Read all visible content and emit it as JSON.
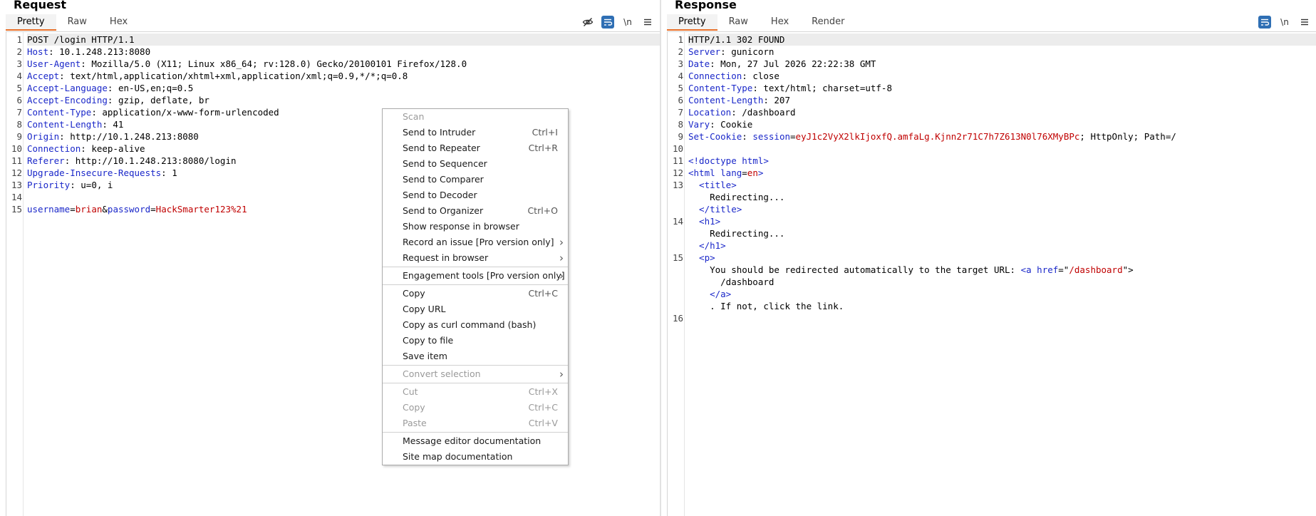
{
  "request": {
    "title": "Request",
    "tabs": [
      "Pretty",
      "Raw",
      "Hex"
    ],
    "active_tab": "Pretty",
    "toolbar_icons": [
      "eye-slash-icon",
      "wrap-lines-icon",
      "newline-icon",
      "menu-icon"
    ],
    "newline_label": "\\n",
    "lines": [
      {
        "n": "1",
        "parts": [
          {
            "t": "POST /login HTTP/1.1",
            "c": "v"
          }
        ]
      },
      {
        "n": "2",
        "parts": [
          {
            "t": "Host",
            "c": "k"
          },
          {
            "t": ": 10.1.248.213:8080",
            "c": "v"
          }
        ]
      },
      {
        "n": "3",
        "parts": [
          {
            "t": "User-Agent",
            "c": "k"
          },
          {
            "t": ": Mozilla/5.0 (X11; Linux x86_64; rv:128.0) Gecko/20100101 Firefox/128.0",
            "c": "v"
          }
        ]
      },
      {
        "n": "4",
        "parts": [
          {
            "t": "Accept",
            "c": "k"
          },
          {
            "t": ": text/html,application/xhtml+xml,application/xml;q=0.9,*/*;q=0.8",
            "c": "v"
          }
        ]
      },
      {
        "n": "5",
        "parts": [
          {
            "t": "Accept-Language",
            "c": "k"
          },
          {
            "t": ": en-US,en;q=0.5",
            "c": "v"
          }
        ]
      },
      {
        "n": "6",
        "parts": [
          {
            "t": "Accept-Encoding",
            "c": "k"
          },
          {
            "t": ": gzip, deflate, br",
            "c": "v"
          }
        ]
      },
      {
        "n": "7",
        "parts": [
          {
            "t": "Content-Type",
            "c": "k"
          },
          {
            "t": ": application/x-www-form-urlencoded",
            "c": "v"
          }
        ]
      },
      {
        "n": "8",
        "parts": [
          {
            "t": "Content-Length",
            "c": "k"
          },
          {
            "t": ": 41",
            "c": "v"
          }
        ]
      },
      {
        "n": "9",
        "parts": [
          {
            "t": "Origin",
            "c": "k"
          },
          {
            "t": ": http://10.1.248.213:8080",
            "c": "v"
          }
        ]
      },
      {
        "n": "10",
        "parts": [
          {
            "t": "Connection",
            "c": "k"
          },
          {
            "t": ": keep-alive",
            "c": "v"
          }
        ]
      },
      {
        "n": "11",
        "parts": [
          {
            "t": "Referer",
            "c": "k"
          },
          {
            "t": ": http://10.1.248.213:8080/login",
            "c": "v"
          }
        ]
      },
      {
        "n": "12",
        "parts": [
          {
            "t": "Upgrade-Insecure-Requests",
            "c": "k"
          },
          {
            "t": ": 1",
            "c": "v"
          }
        ]
      },
      {
        "n": "13",
        "parts": [
          {
            "t": "Priority",
            "c": "k"
          },
          {
            "t": ": u=0, i",
            "c": "v"
          }
        ]
      },
      {
        "n": "14",
        "parts": []
      },
      {
        "n": "15",
        "parts": [
          {
            "t": "username",
            "c": "k"
          },
          {
            "t": "=",
            "c": "v"
          },
          {
            "t": "brian",
            "c": "r"
          },
          {
            "t": "&",
            "c": "v"
          },
          {
            "t": "password",
            "c": "k"
          },
          {
            "t": "=",
            "c": "v"
          },
          {
            "t": "HackSmarter123%21",
            "c": "r"
          }
        ]
      }
    ]
  },
  "response": {
    "title": "Response",
    "tabs": [
      "Pretty",
      "Raw",
      "Hex",
      "Render"
    ],
    "active_tab": "Pretty",
    "toolbar_icons": [
      "wrap-lines-icon",
      "newline-icon",
      "menu-icon"
    ],
    "newline_label": "\\n",
    "lines": [
      {
        "n": "1",
        "parts": [
          {
            "t": "HTTP/1.1 302 FOUND",
            "c": "v"
          }
        ]
      },
      {
        "n": "2",
        "parts": [
          {
            "t": "Server",
            "c": "k"
          },
          {
            "t": ": gunicorn",
            "c": "v"
          }
        ]
      },
      {
        "n": "3",
        "parts": [
          {
            "t": "Date",
            "c": "k"
          },
          {
            "t": ": Mon, 27 Jul 2026 22:22:38 GMT",
            "c": "v"
          }
        ]
      },
      {
        "n": "4",
        "parts": [
          {
            "t": "Connection",
            "c": "k"
          },
          {
            "t": ": close",
            "c": "v"
          }
        ]
      },
      {
        "n": "5",
        "parts": [
          {
            "t": "Content-Type",
            "c": "k"
          },
          {
            "t": ": text/html; charset=utf-8",
            "c": "v"
          }
        ]
      },
      {
        "n": "6",
        "parts": [
          {
            "t": "Content-Length",
            "c": "k"
          },
          {
            "t": ": 207",
            "c": "v"
          }
        ]
      },
      {
        "n": "7",
        "parts": [
          {
            "t": "Location",
            "c": "k"
          },
          {
            "t": ": /dashboard",
            "c": "v"
          }
        ]
      },
      {
        "n": "8",
        "parts": [
          {
            "t": "Vary",
            "c": "k"
          },
          {
            "t": ": Cookie",
            "c": "v"
          }
        ]
      },
      {
        "n": "9",
        "parts": [
          {
            "t": "Set-Cookie",
            "c": "k"
          },
          {
            "t": ": ",
            "c": "v"
          },
          {
            "t": "session",
            "c": "k"
          },
          {
            "t": "=",
            "c": "v"
          },
          {
            "t": "eyJ1c2VyX2lkIjoxfQ.amfaLg.Kjnn2r71C7h7Z613N0l76XMyBPc",
            "c": "r"
          },
          {
            "t": "; HttpOnly; Path=/",
            "c": "v"
          }
        ]
      },
      {
        "n": "10",
        "parts": []
      },
      {
        "n": "11",
        "parts": [
          {
            "t": "<!doctype html>",
            "c": "tg"
          }
        ]
      },
      {
        "n": "12",
        "parts": [
          {
            "t": "<html ",
            "c": "tg"
          },
          {
            "t": "lang",
            "c": "k"
          },
          {
            "t": "=",
            "c": "v"
          },
          {
            "t": "en",
            "c": "r"
          },
          {
            "t": ">",
            "c": "tg"
          }
        ]
      },
      {
        "n": "13",
        "parts": [
          {
            "t": "  <title>",
            "c": "tg"
          }
        ]
      },
      {
        "n": "",
        "parts": [
          {
            "t": "    Redirecting...",
            "c": "v"
          }
        ]
      },
      {
        "n": "",
        "parts": [
          {
            "t": "  </title>",
            "c": "tg"
          }
        ]
      },
      {
        "n": "14",
        "parts": [
          {
            "t": "  <h1>",
            "c": "tg"
          }
        ]
      },
      {
        "n": "",
        "parts": [
          {
            "t": "    Redirecting...",
            "c": "v"
          }
        ]
      },
      {
        "n": "",
        "parts": [
          {
            "t": "  </h1>",
            "c": "tg"
          }
        ]
      },
      {
        "n": "15",
        "parts": [
          {
            "t": "  <p>",
            "c": "tg"
          }
        ]
      },
      {
        "n": "",
        "parts": [
          {
            "t": "    You should be redirected automatically to the target URL: ",
            "c": "v"
          },
          {
            "t": "<a ",
            "c": "tg"
          },
          {
            "t": "href",
            "c": "k"
          },
          {
            "t": "=\"",
            "c": "v"
          },
          {
            "t": "/dashboard",
            "c": "r"
          },
          {
            "t": "\">",
            "c": "v"
          }
        ]
      },
      {
        "n": "",
        "parts": [
          {
            "t": "      /dashboard",
            "c": "v"
          }
        ]
      },
      {
        "n": "",
        "parts": [
          {
            "t": "    </a>",
            "c": "tg"
          }
        ]
      },
      {
        "n": "",
        "parts": [
          {
            "t": "    . If not, click the link.",
            "c": "v"
          }
        ]
      },
      {
        "n": "16",
        "parts": []
      }
    ]
  },
  "context_menu": {
    "items": [
      {
        "label": "Scan",
        "shortcut": "",
        "disabled": true,
        "submenu": false
      },
      {
        "label": "Send to Intruder",
        "shortcut": "Ctrl+I",
        "disabled": false,
        "submenu": false
      },
      {
        "label": "Send to Repeater",
        "shortcut": "Ctrl+R",
        "disabled": false,
        "submenu": false
      },
      {
        "label": "Send to Sequencer",
        "shortcut": "",
        "disabled": false,
        "submenu": false
      },
      {
        "label": "Send to Comparer",
        "shortcut": "",
        "disabled": false,
        "submenu": false
      },
      {
        "label": "Send to Decoder",
        "shortcut": "",
        "disabled": false,
        "submenu": false
      },
      {
        "label": "Send to Organizer",
        "shortcut": "Ctrl+O",
        "disabled": false,
        "submenu": false
      },
      {
        "label": "Show response in browser",
        "shortcut": "",
        "disabled": false,
        "submenu": false
      },
      {
        "label": "Record an issue [Pro version only]",
        "shortcut": "",
        "disabled": false,
        "submenu": true
      },
      {
        "label": "Request in browser",
        "shortcut": "",
        "disabled": false,
        "submenu": true
      },
      {
        "sep": true
      },
      {
        "label": "Engagement tools [Pro version only]",
        "shortcut": "",
        "disabled": false,
        "submenu": true
      },
      {
        "sep": true
      },
      {
        "label": "Copy",
        "shortcut": "Ctrl+C",
        "disabled": false,
        "submenu": false
      },
      {
        "label": "Copy URL",
        "shortcut": "",
        "disabled": false,
        "submenu": false
      },
      {
        "label": "Copy as curl command (bash)",
        "shortcut": "",
        "disabled": false,
        "submenu": false
      },
      {
        "label": "Copy to file",
        "shortcut": "",
        "disabled": false,
        "submenu": false
      },
      {
        "label": "Save item",
        "shortcut": "",
        "disabled": false,
        "submenu": false
      },
      {
        "sep": true
      },
      {
        "label": "Convert selection",
        "shortcut": "",
        "disabled": true,
        "submenu": true
      },
      {
        "sep": true
      },
      {
        "label": "Cut",
        "shortcut": "Ctrl+X",
        "disabled": true,
        "submenu": false
      },
      {
        "label": "Copy",
        "shortcut": "Ctrl+C",
        "disabled": true,
        "submenu": false
      },
      {
        "label": "Paste",
        "shortcut": "Ctrl+V",
        "disabled": true,
        "submenu": false
      },
      {
        "sep": true
      },
      {
        "label": "Message editor documentation",
        "shortcut": "",
        "disabled": false,
        "submenu": false
      },
      {
        "label": "Site map documentation",
        "shortcut": "",
        "disabled": false,
        "submenu": false
      }
    ]
  },
  "colors": {
    "accent": "#e8702a",
    "toggle_on": "#2f6fb4",
    "header_name": "#1a27c9",
    "value_red": "#c00000"
  }
}
